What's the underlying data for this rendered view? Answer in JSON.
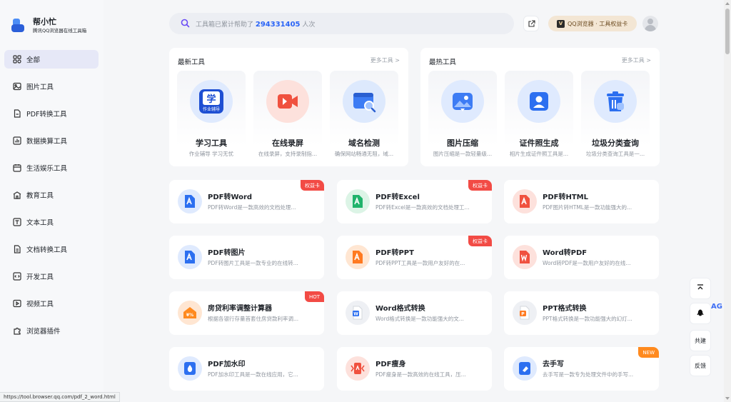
{
  "brand": {
    "name": "帮小忙",
    "subtitle": "腾讯QQ浏览器在线工具箱"
  },
  "sidebar": {
    "items": [
      {
        "label": "全部",
        "icon": "grid-icon",
        "active": true
      },
      {
        "label": "图片工具",
        "icon": "image-icon"
      },
      {
        "label": "PDF转换工具",
        "icon": "pdf-icon"
      },
      {
        "label": "数据换算工具",
        "icon": "chart-icon"
      },
      {
        "label": "生活娱乐工具",
        "icon": "calendar-icon"
      },
      {
        "label": "教育工具",
        "icon": "school-icon"
      },
      {
        "label": "文本工具",
        "icon": "text-icon"
      },
      {
        "label": "文档转换工具",
        "icon": "document-icon"
      },
      {
        "label": "开发工具",
        "icon": "code-icon"
      },
      {
        "label": "视频工具",
        "icon": "video-icon"
      },
      {
        "label": "浏览器插件",
        "icon": "plugin-icon"
      }
    ]
  },
  "search": {
    "prefix": "工具箱已累计帮助了",
    "count": "294331405",
    "suffix": "人次"
  },
  "header": {
    "qq_badge": "QQ浏览器 · 工具权益卡",
    "qq_badge_letter": "V"
  },
  "latest": {
    "title": "最新工具",
    "more": "更多工具 >",
    "tools": [
      {
        "name": "学习工具",
        "desc": "作业辅导 学习无忧"
      },
      {
        "name": "在线录屏",
        "desc": "在线录屏，支持录制指..."
      },
      {
        "name": "域名检测",
        "desc": "确保网站畅通无阻，域..."
      }
    ]
  },
  "hot": {
    "title": "最热工具",
    "more": "更多工具 >",
    "tools": [
      {
        "name": "图片压缩",
        "desc": "图片压缩是一款轻量级..."
      },
      {
        "name": "证件照生成",
        "desc": "相片生成证件照工具是..."
      },
      {
        "name": "垃圾分类查询",
        "desc": "垃圾分类查询工具是一..."
      }
    ]
  },
  "study_icon_text": {
    "top": "学",
    "bottom": "作业辅导"
  },
  "cards": [
    {
      "title": "PDF转Word",
      "desc": "PDF转Word是一款高效的文档处理...",
      "badge": "权益卡"
    },
    {
      "title": "PDF转Excel",
      "desc": "PDF转Excel是一款高效的文档处理工...",
      "badge": "权益卡"
    },
    {
      "title": "PDF转HTML",
      "desc": "PDF图片转HTML是一款功能强大的..."
    },
    {
      "title": "PDF转图片",
      "desc": "PDF转图片工具是一款专业的在线转..."
    },
    {
      "title": "PDF转PPT",
      "desc": "PDF转PPT工具是一款用户友好的在...",
      "badge": "权益卡"
    },
    {
      "title": "Word转PDF",
      "desc": "Word转PDF是一款用户友好的在线..."
    },
    {
      "title": "房贷利率调整计算器",
      "desc": "根据各银行存量首套住房贷款利率调...",
      "badge": "HOT"
    },
    {
      "title": "Word格式转换",
      "desc": "Word格式转换是一款功能强大的文..."
    },
    {
      "title": "PPT格式转换",
      "desc": "PPT格式转换是一款功能强大的幻灯..."
    },
    {
      "title": "PDF加水印",
      "desc": "PDF加水印工具是一款在线应用，它..."
    },
    {
      "title": "PDF瘦身",
      "desc": "PDF瘦身是一款高效的在线工具，压..."
    },
    {
      "title": "去手写",
      "desc": "去手写是一款专为处理文件中的手写...",
      "badge": "NEW"
    }
  ],
  "float": {
    "cobuild": "共建",
    "feedback": "反馈",
    "ag_text": "AG"
  },
  "statusbar": {
    "url": "https://tool.browser.qq.com/pdf_2_word.html"
  }
}
